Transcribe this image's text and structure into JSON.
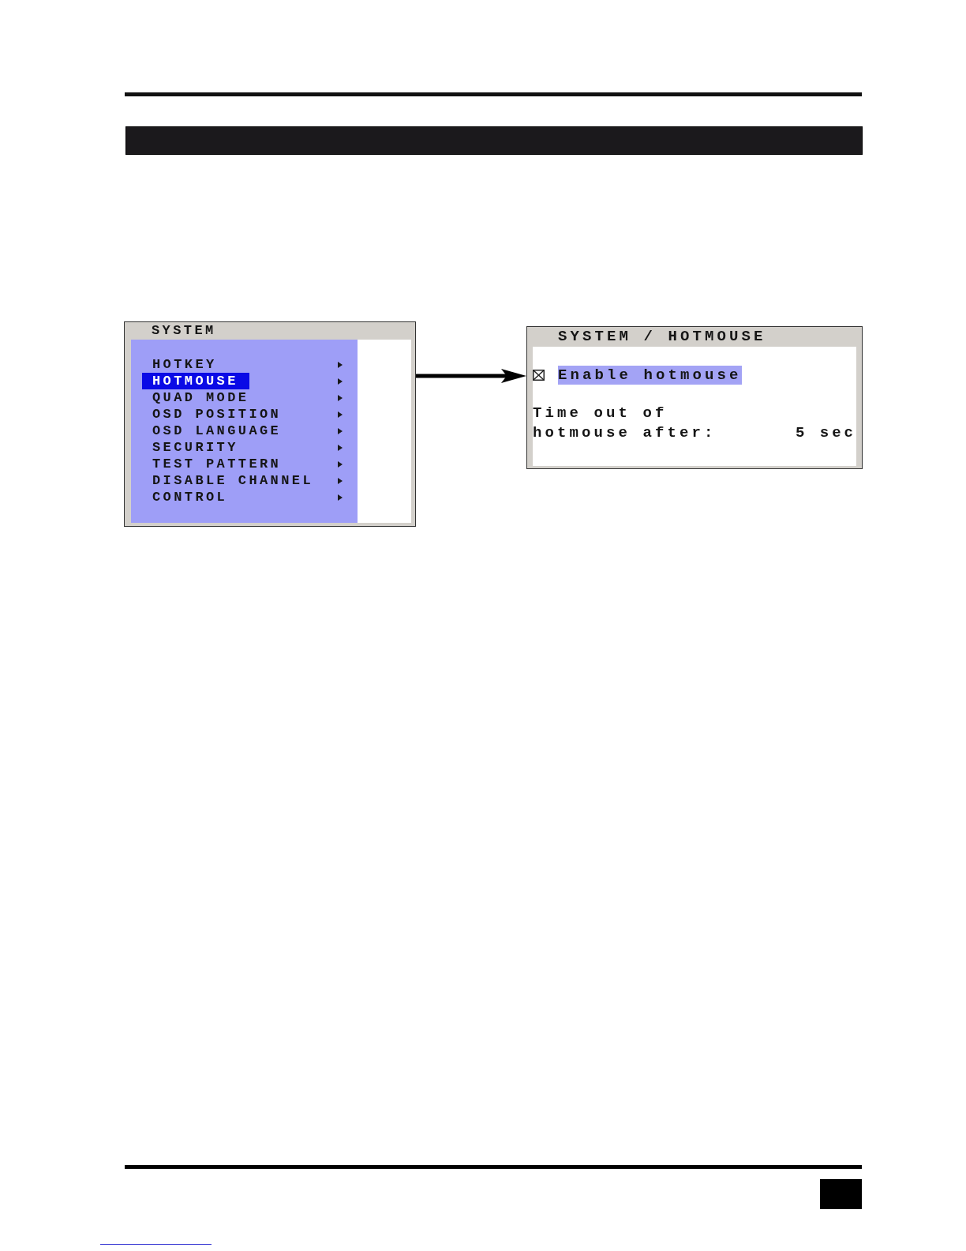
{
  "left_window": {
    "title": "SYSTEM",
    "items": [
      {
        "label": "HOTKEY",
        "selected": false
      },
      {
        "label": "HOTMOUSE",
        "selected": true
      },
      {
        "label": "QUAD MODE",
        "selected": false
      },
      {
        "label": "OSD POSITION",
        "selected": false
      },
      {
        "label": "OSD LANGUAGE",
        "selected": false
      },
      {
        "label": "SECURITY",
        "selected": false
      },
      {
        "label": "TEST PATTERN",
        "selected": false
      },
      {
        "label": "DISABLE CHANNEL",
        "selected": false
      },
      {
        "label": "CONTROL",
        "selected": false
      }
    ]
  },
  "right_window": {
    "title": "SYSTEM / HOTMOUSE",
    "checkbox": {
      "label": "Enable hotmouse",
      "checked": true,
      "focused": true
    },
    "timeout": {
      "label": "Time out of hotmouse after:",
      "value": "5 sec"
    }
  }
}
